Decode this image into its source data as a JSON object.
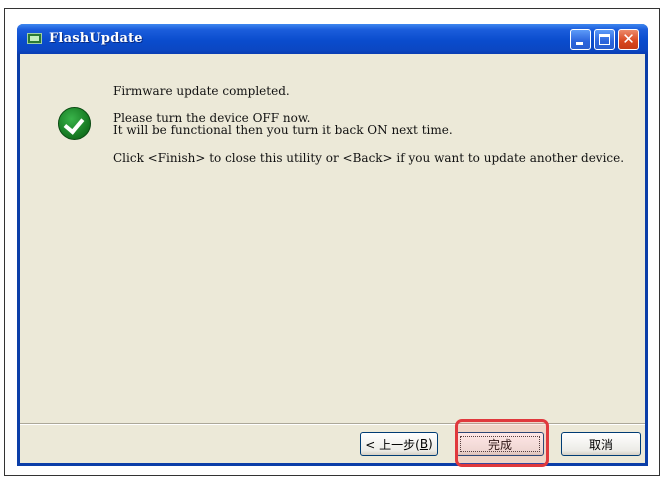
{
  "window": {
    "title": "FlashUpdate",
    "icon": "app-icon"
  },
  "message": {
    "line1": "Firmware update completed.",
    "line2": "Please turn the device OFF now.",
    "line3": "It will be functional then you turn it back ON next time.",
    "line4": "Click <Finish> to close this utility or <Back> if you want to update another device."
  },
  "buttons": {
    "back_prefix": "< 上一步(",
    "back_key": "B",
    "back_suffix": ")",
    "finish": "完成",
    "cancel": "取消"
  },
  "colors": {
    "titlebar": "#0a4ccd",
    "dialog_bg": "#ece9d8",
    "highlight": "#e0393d",
    "success": "#13741f"
  }
}
